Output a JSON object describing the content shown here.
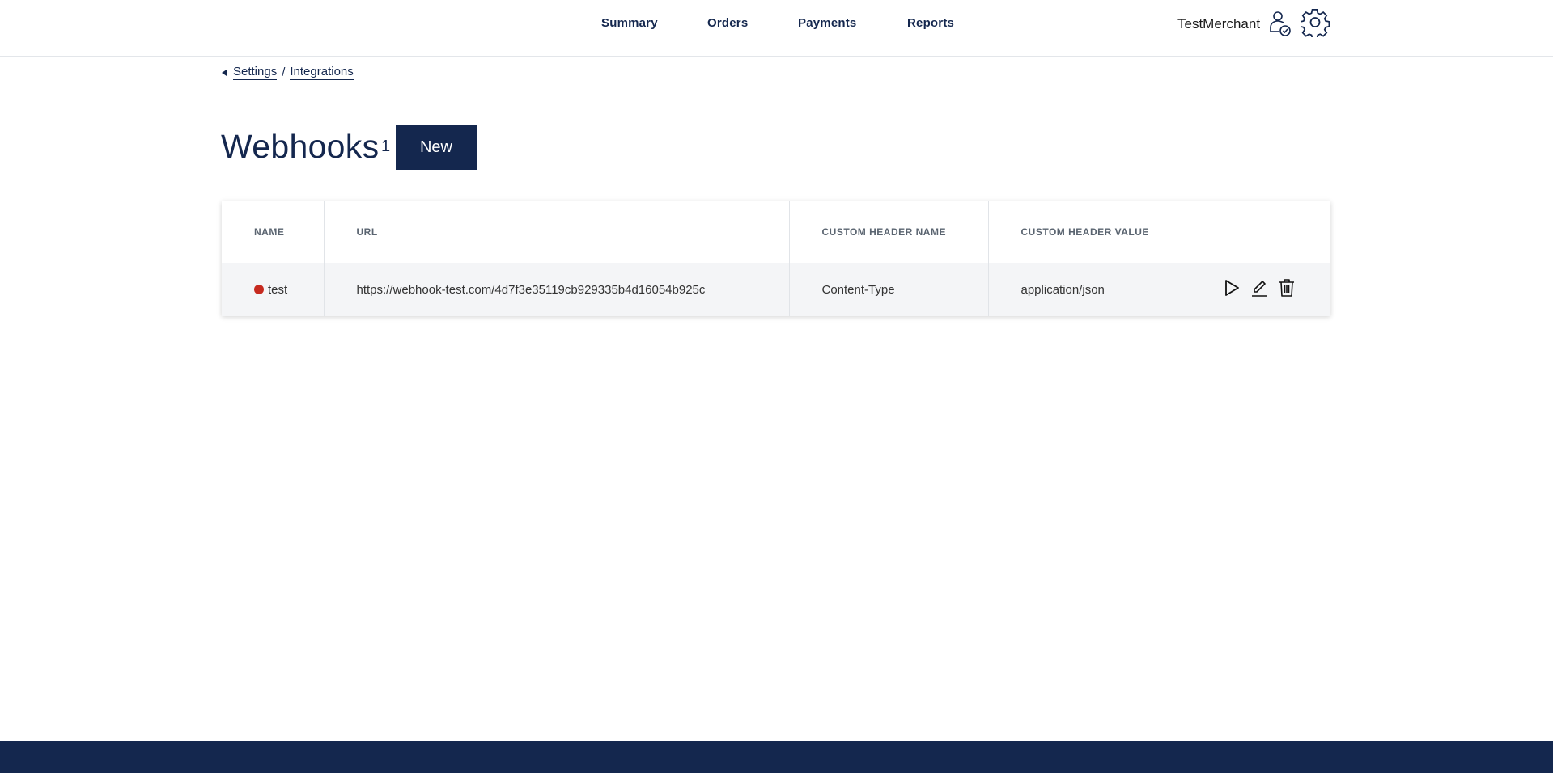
{
  "nav": {
    "items": [
      {
        "label": "Summary"
      },
      {
        "label": "Orders"
      },
      {
        "label": "Payments"
      },
      {
        "label": "Reports"
      }
    ],
    "merchant_name": "TestMerchant",
    "icons": {
      "user": "user-shield-icon",
      "settings": "gear-icon"
    }
  },
  "breadcrumb": {
    "items": [
      {
        "label": "Settings"
      },
      {
        "label": "Integrations"
      }
    ],
    "separator": "/"
  },
  "page": {
    "title": "Webhooks",
    "count": "1",
    "new_button": "New"
  },
  "table": {
    "columns": [
      "NAME",
      "URL",
      "CUSTOM HEADER NAME",
      "CUSTOM HEADER VALUE",
      ""
    ],
    "rows": [
      {
        "name": "test",
        "status_color": "#c62a1f",
        "url": "https://webhook-test.com/4d7f3e35119cb929335b4d16054b925c",
        "header_name": "Content-Type",
        "header_value": "application/json",
        "actions": [
          "play-icon",
          "edit-icon",
          "trash-icon"
        ]
      }
    ]
  },
  "colors": {
    "brand": "#14274e",
    "footer": "#14274e",
    "row_bg": "#f4f5f7",
    "status_inactive": "#c62a1f"
  }
}
